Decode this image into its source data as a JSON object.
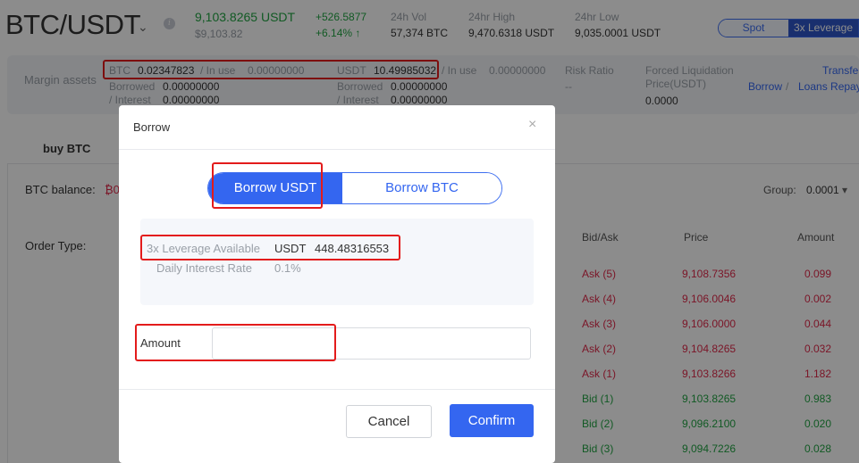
{
  "header": {
    "pair": "BTC/USDT",
    "last_price": "9,103.8265 USDT",
    "last_price_fiat": "$9,103.82",
    "change_abs": "+526.5877",
    "change_pct": "+6.14%",
    "vol_label": "24h Vol",
    "vol_value": "57,374 BTC",
    "high_label": "24hr High",
    "high_value": "9,470.6318 USDT",
    "low_label": "24hr Low",
    "low_value": "9,035.0001 USDT",
    "mode_spot": "Spot",
    "mode_leverage": "3x Leverage"
  },
  "margin": {
    "label": "Margin assets",
    "btc_label": "BTC",
    "btc_value": "0.02347823",
    "btc_inuse_label": "/  In use",
    "btc_inuse_value": "0.00000000",
    "btc_borrowed_label": "Borrowed",
    "btc_borrowed_value": "0.00000000",
    "btc_interest_label": "/  Interest",
    "btc_interest_value": "0.00000000",
    "usdt_label": "USDT",
    "usdt_value": "10.49985032",
    "usdt_inuse_label": "/  In use",
    "usdt_inuse_value": "0.00000000",
    "usdt_borrowed_label": "Borrowed",
    "usdt_borrowed_value": "0.00000000",
    "usdt_interest_label": "/  Interest",
    "usdt_interest_value": "0.00000000",
    "risk_label": "Risk Ratio",
    "risk_value": "--",
    "forced_label_1": "Forced Liquidation",
    "forced_label_2": "Price(USDT)",
    "forced_value": "0.0000",
    "transfer": "Transfer",
    "borrow": "Borrow",
    "sep": "/",
    "loans_repay": "Loans Repay"
  },
  "trade": {
    "buy_tab": "buy BTC",
    "balance_label": "BTC balance:",
    "balance_value": "₿0",
    "order_type_label": "Order Type:",
    "group_label": "Group:",
    "group_value": "0.0001"
  },
  "orderbook": {
    "headers": [
      "Bid/Ask",
      "Price",
      "Amount"
    ],
    "rows": [
      {
        "side": "Ask (5)",
        "price": "9,108.7356",
        "amount": "0.099"
      },
      {
        "side": "Ask (4)",
        "price": "9,106.0046",
        "amount": "0.002"
      },
      {
        "side": "Ask (3)",
        "price": "9,106.0000",
        "amount": "0.044"
      },
      {
        "side": "Ask (2)",
        "price": "9,104.8265",
        "amount": "0.032"
      },
      {
        "side": "Ask (1)",
        "price": "9,103.8266",
        "amount": "1.182"
      },
      {
        "side": "Bid (1)",
        "price": "9,103.8265",
        "amount": "0.983"
      },
      {
        "side": "Bid (2)",
        "price": "9,096.2100",
        "amount": "0.020"
      },
      {
        "side": "Bid (3)",
        "price": "9,094.7226",
        "amount": "0.028"
      }
    ]
  },
  "modal": {
    "title": "Borrow",
    "close": "×",
    "tab_usdt": "Borrow USDT",
    "tab_btc": "Borrow BTC",
    "available_label": "3x Leverage Available",
    "available_currency": "USDT",
    "available_value": "448.48316553",
    "interest_label": "Daily Interest Rate",
    "interest_value": "0.1%",
    "amount_label": "Amount",
    "amount_value": "",
    "amount_placeholder": "",
    "cancel": "Cancel",
    "confirm": "Confirm"
  },
  "colors": {
    "accent": "#3466f0",
    "ask": "#e0294a",
    "bid": "#21a443",
    "highlight": "#e31b1b"
  }
}
